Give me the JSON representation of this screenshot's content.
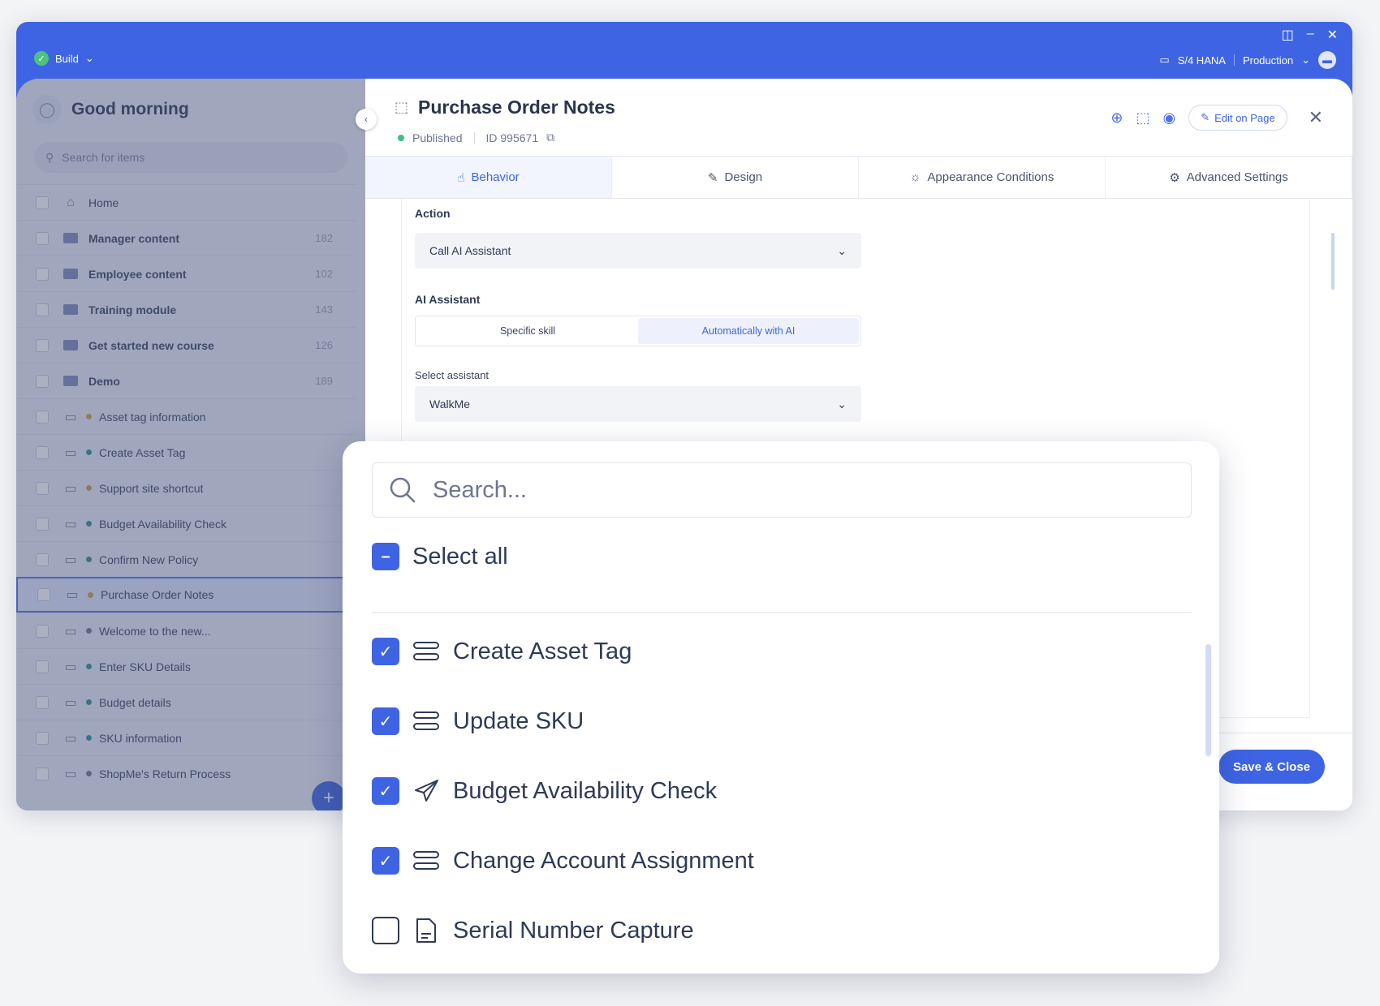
{
  "topbar": {
    "build_label": "Build",
    "system_label": "S/4 HANA",
    "env_label": "Production"
  },
  "sidebar": {
    "greeting": "Good morning",
    "search_placeholder": "Search for items",
    "items": [
      {
        "label": "Home",
        "kind": "home"
      },
      {
        "label": "Manager content",
        "kind": "folder",
        "count": "182"
      },
      {
        "label": "Employee content",
        "kind": "folder",
        "count": "102"
      },
      {
        "label": "Training module",
        "kind": "folder",
        "count": "143"
      },
      {
        "label": "Get started new course",
        "kind": "folder",
        "count": "126"
      },
      {
        "label": "Demo",
        "kind": "folder",
        "count": "189"
      },
      {
        "label": "Asset tag information",
        "kind": "item",
        "dot": "#c9a24a"
      },
      {
        "label": "Create Asset Tag",
        "kind": "item",
        "dot": "#2f8f8f"
      },
      {
        "label": "Support site shortcut",
        "kind": "item",
        "dot": "#c9a24a"
      },
      {
        "label": "Budget Availability Check",
        "kind": "item",
        "dot": "#2f8f8f"
      },
      {
        "label": "Confirm New Policy",
        "kind": "item",
        "dot": "#2f8f8f"
      },
      {
        "label": "Purchase Order Notes",
        "kind": "item",
        "dot": "#c9a24a",
        "active": true
      },
      {
        "label": "Welcome to the new...",
        "kind": "item",
        "dot": "#6f7690"
      },
      {
        "label": "Enter SKU Details",
        "kind": "item",
        "dot": "#2f8f8f"
      },
      {
        "label": "Budget details",
        "kind": "item",
        "dot": "#2f8f8f"
      },
      {
        "label": "SKU information",
        "kind": "item",
        "dot": "#2f8f8f"
      },
      {
        "label": "ShopMe's Return Process",
        "kind": "item",
        "dot": "#6f7690"
      }
    ]
  },
  "editor": {
    "title": "Purchase Order Notes",
    "status": "Published",
    "id_label": "ID 995671",
    "edit_on_page": "Edit on Page",
    "tabs": [
      "Behavior",
      "Design",
      "Appearance Conditions",
      "Advanced Settings"
    ],
    "action_label": "Action",
    "action_value": "Call AI Assistant",
    "assistant_label": "AI Assistant",
    "seg_options": [
      "Specific skill",
      "Automatically with AI"
    ],
    "select_assistant_label": "Select assistant",
    "select_assistant_value": "WalkMe",
    "save_close": "Save & Close"
  },
  "dropdown": {
    "search_placeholder": "Search...",
    "select_all": "Select all",
    "options": [
      {
        "label": "Create Asset Tag",
        "checked": true,
        "icon": "flow-icon"
      },
      {
        "label": "Update SKU",
        "checked": true,
        "icon": "flow-icon"
      },
      {
        "label": "Budget Availability Check",
        "checked": true,
        "icon": "paper-plane-icon"
      },
      {
        "label": "Change Account Assignment",
        "checked": true,
        "icon": "flow-icon"
      },
      {
        "label": "Serial Number Capture",
        "checked": false,
        "icon": "document-icon"
      }
    ]
  },
  "colors": {
    "accent": "#3e64e4",
    "published": "#3cbf8a"
  }
}
